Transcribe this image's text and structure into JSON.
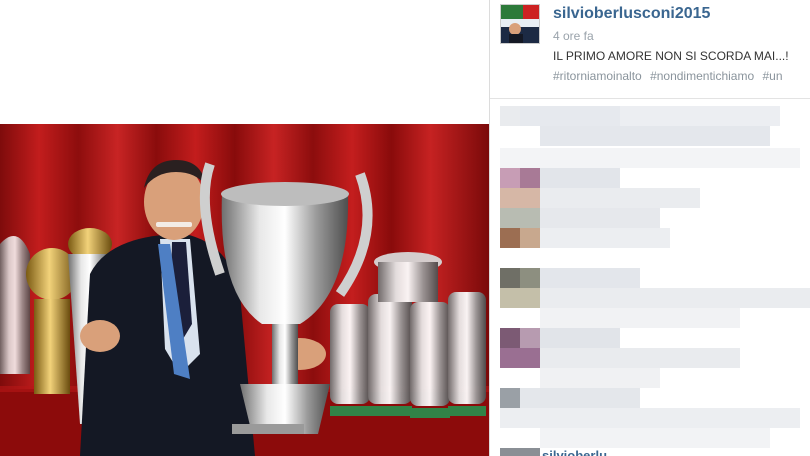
{
  "post": {
    "username": "silvioberlusconi2015",
    "time_ago": "4 ore fa",
    "caption": "IL PRIMO AMORE NON SI SCORDA MAI...!",
    "hashtags": [
      "#ritorniamoinalto",
      "#nondimentichiamo",
      "#un"
    ]
  },
  "photo": {
    "subject": "man-with-trophies",
    "background_color": "#b01616",
    "floor_color": "#8c0b0b"
  },
  "comments": {
    "pixelated": true,
    "count_visible": 8,
    "partial_bottom_text": "silvioberlu"
  },
  "colors": {
    "username": "#3a6690",
    "hashtag": "#8a949c",
    "divider": "#dcdcdc"
  }
}
